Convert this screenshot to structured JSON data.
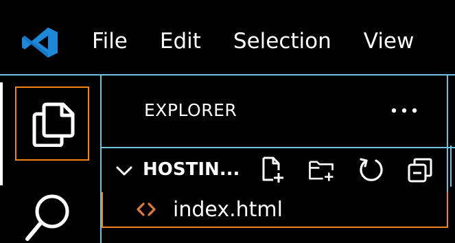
{
  "menu": {
    "items": [
      "File",
      "Edit",
      "Selection",
      "View"
    ]
  },
  "activity_bar": {
    "explorer_icon": "files-icon",
    "search_icon": "search-icon"
  },
  "explorer": {
    "title": "EXPLORER",
    "more_icon": "ellipsis-icon",
    "section": {
      "title": "HOSTIN...",
      "expanded": true,
      "actions": [
        "new-file-icon",
        "new-folder-icon",
        "refresh-icon",
        "collapse-all-icon"
      ]
    },
    "files": [
      {
        "name": "index.html",
        "icon": "html-code-icon"
      }
    ]
  },
  "colors": {
    "background": "#000000",
    "border_contrast": "#6fc3df",
    "focus_border": "#f38518",
    "logo_blue": "#1e88d8",
    "html_icon": "#e37933",
    "text": "#ffffff"
  }
}
